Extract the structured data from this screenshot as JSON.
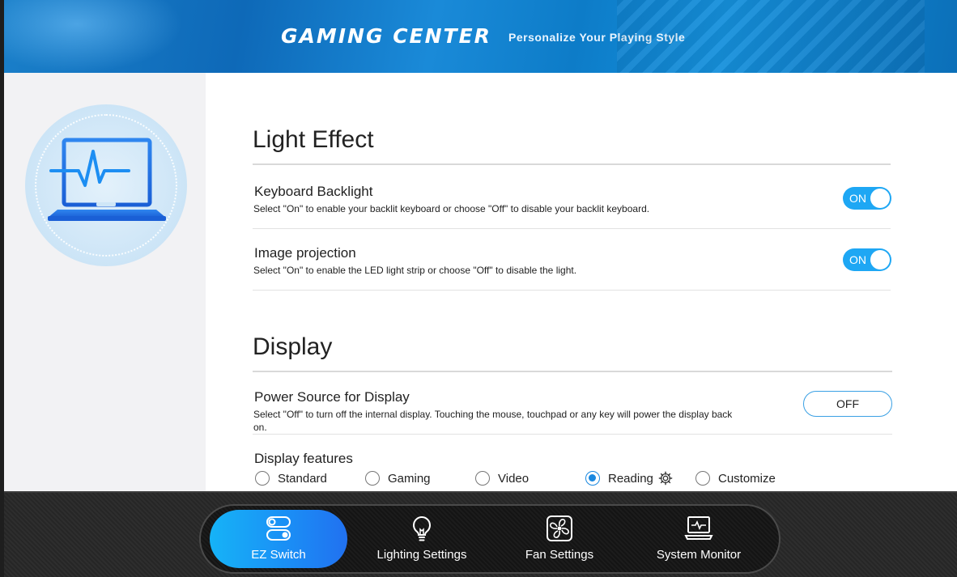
{
  "header": {
    "brand": "GAMING CENTER",
    "tagline": "Personalize Your Playing Style"
  },
  "sidepanel": {
    "hero_icon": "laptop-pulse-icon"
  },
  "light_effect": {
    "title": "Light Effect",
    "keyboard_backlight": {
      "title": "Keyboard Backlight",
      "desc": "Select \"On\" to enable your backlit keyboard or choose \"Off\" to disable your backlit keyboard.",
      "state": "ON"
    },
    "image_projection": {
      "title": "Image projection",
      "desc": "Select \"On\" to enable the LED light strip or choose \"Off\" to disable the light.",
      "state": "ON"
    }
  },
  "display": {
    "title": "Display",
    "power_source": {
      "title": "Power Source for Display",
      "desc": "Select \"Off\" to turn off the internal display. Touching the mouse, touchpad or any key will power the display back on.",
      "state": "OFF"
    },
    "features": {
      "title": "Display features",
      "options": [
        "Standard",
        "Gaming",
        "Video",
        "Reading",
        "Customize"
      ],
      "selected": "Reading"
    }
  },
  "dock": {
    "items": [
      {
        "label": "EZ Switch",
        "icon": "toggle-switch-icon",
        "active": true
      },
      {
        "label": "Lighting Settings",
        "icon": "lightbulb-icon",
        "active": false
      },
      {
        "label": "Fan Settings",
        "icon": "fan-icon",
        "active": false
      },
      {
        "label": "System Monitor",
        "icon": "laptop-monitor-icon",
        "active": false
      }
    ]
  },
  "colors": {
    "accent": "#1ea7f4",
    "radio_selected": "#1a88e0",
    "dock_active_start": "#16b3f7",
    "dock_active_end": "#2171f0"
  }
}
